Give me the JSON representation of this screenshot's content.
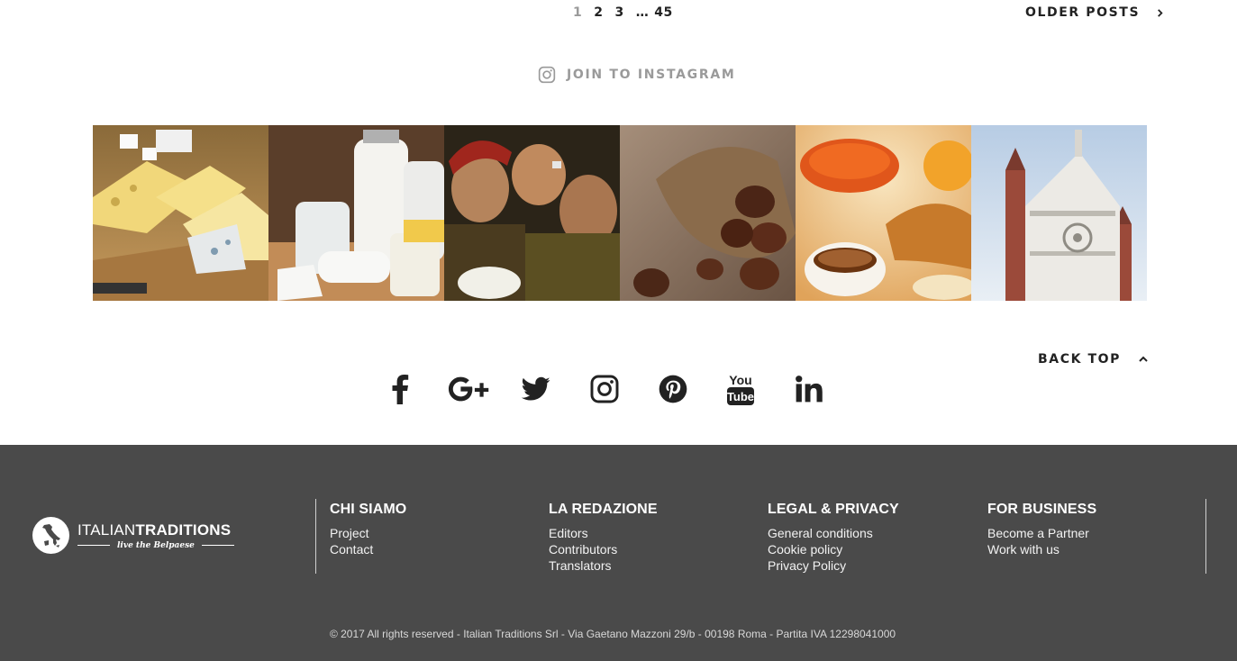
{
  "pagination": {
    "pages": [
      "1",
      "2",
      "3"
    ],
    "current": "1",
    "ellipsis": "…",
    "last": "45",
    "older_label": "OLDER POSTS"
  },
  "instagram": {
    "heading": "JOIN TO INSTAGRAM",
    "photos": [
      {
        "subject": "cheese-board"
      },
      {
        "subject": "milk-and-dairy"
      },
      {
        "subject": "painting-eating-ricotta"
      },
      {
        "subject": "chestnuts-in-sack"
      },
      {
        "subject": "breakfast-coffee-croissant-jam"
      },
      {
        "subject": "cremona-cathedral"
      }
    ]
  },
  "back_top_label": "BACK TOP",
  "social": [
    "facebook-icon",
    "google-plus-icon",
    "twitter-icon",
    "instagram-icon",
    "pinterest-icon",
    "youtube-icon",
    "linkedin-icon"
  ],
  "youtube_text": {
    "top": "You",
    "bottom": "Tube"
  },
  "footer": {
    "logo": {
      "thin": "ITALIAN",
      "bold": "TRADITIONS",
      "tagline": "live the Belpaese"
    },
    "columns": [
      {
        "title": "CHI SIAMO",
        "links": [
          "Project",
          "Contact"
        ]
      },
      {
        "title": "LA REDAZIONE",
        "links": [
          "Editors",
          "Contributors",
          "Translators"
        ]
      },
      {
        "title": "LEGAL & PRIVACY",
        "links": [
          "General conditions",
          "Cookie policy",
          "Privacy Policy"
        ]
      },
      {
        "title": "FOR BUSINESS",
        "links": [
          "Become a Partner",
          "Work with us"
        ]
      }
    ],
    "copyright": "© 2017 All rights reserved - Italian Traditions Srl - Via Gaetano Mazzoni 29/b - 00198 Roma - Partita IVA 12298041000"
  },
  "colors": {
    "footer_bg": "#4a4a4a",
    "muted_text": "#9a9a9a",
    "dark_text": "#222222"
  }
}
